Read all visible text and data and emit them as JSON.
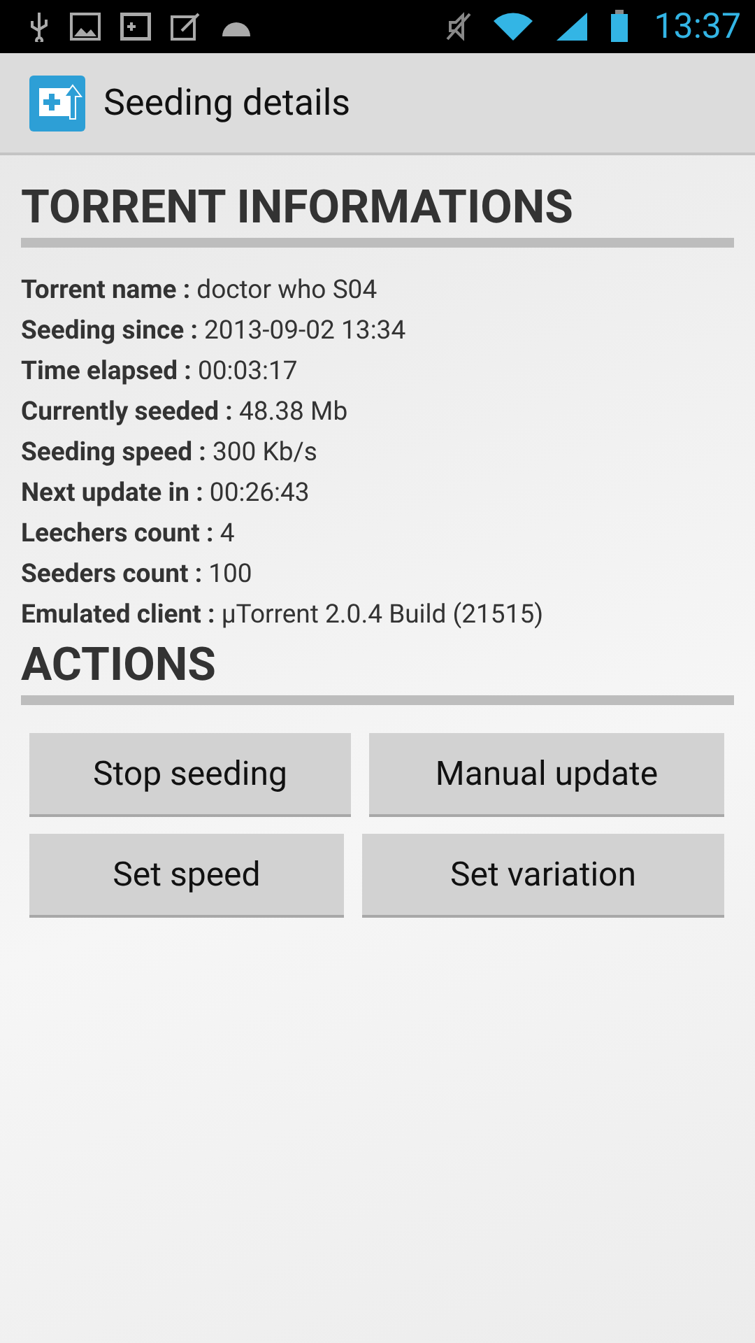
{
  "status_bar": {
    "time": "13:37"
  },
  "action_bar": {
    "title": "Seeding details"
  },
  "sections": [
    {
      "title": "TORRENT INFORMATIONS",
      "fields": [
        {
          "label": "Torrent name :",
          "value": "doctor who S04"
        },
        {
          "label": "Seeding since :",
          "value": "2013-09-02 13:34"
        },
        {
          "label": "Time elapsed :",
          "value": "00:03:17"
        },
        {
          "label": "Currently seeded :",
          "value": "48.38 Mb"
        },
        {
          "label": "Seeding speed :",
          "value": "300 Kb/s"
        },
        {
          "label": "Next update in :",
          "value": "00:26:43"
        },
        {
          "label": "Leechers count :",
          "value": "4"
        },
        {
          "label": "Seeders count :",
          "value": "100"
        },
        {
          "label": "Emulated client :",
          "value": "µTorrent 2.0.4 Build (21515)"
        }
      ]
    },
    {
      "title": "ACTIONS",
      "button_rows": [
        [
          "Stop seeding",
          "Manual update"
        ],
        [
          "Set speed",
          "Set variation"
        ]
      ]
    }
  ]
}
